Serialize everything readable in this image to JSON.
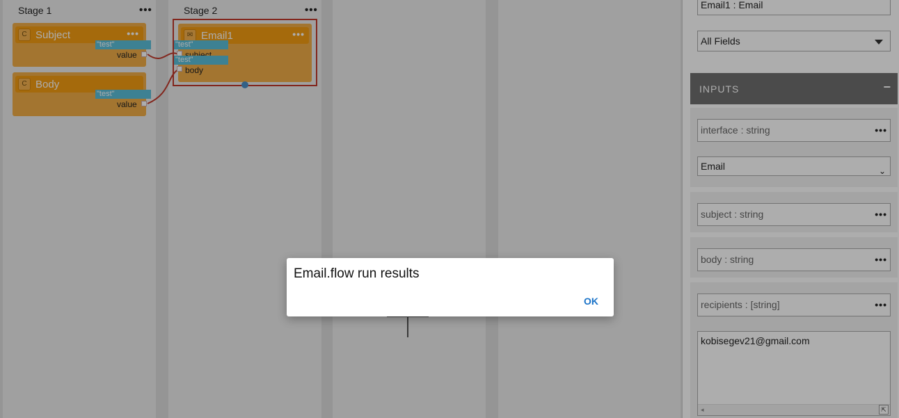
{
  "stages": [
    {
      "title": "Stage 1",
      "nodes": [
        {
          "icon": "C",
          "title": "Subject",
          "chip": "\"test\"",
          "port_label": "value"
        },
        {
          "icon": "C",
          "title": "Body",
          "chip": "\"test\"",
          "port_label": "value"
        }
      ]
    },
    {
      "title": "Stage 2",
      "nodes": [
        {
          "icon": "✉",
          "title": "Email1",
          "chips": [
            "\"test\"",
            "\"test\""
          ],
          "ports": [
            "subject",
            "body"
          ]
        }
      ]
    }
  ],
  "panel": {
    "node_name": "Email1 : Email",
    "filter_select": "All Fields",
    "inputs_title": "INPUTS",
    "inputs_toggle": "−",
    "fields": {
      "interface_label": "interface : string",
      "interface_value": "Email",
      "subject_label": "subject : string",
      "body_label": "body : string",
      "recipients_label": "recipients : [string]",
      "recipients_value": "kobisegev21@gmail.com"
    }
  },
  "dialog": {
    "title": "Email.flow run results",
    "ok_label": "OK"
  },
  "colors": {
    "node_fill": "#f0ad48",
    "node_header": "#f39c12",
    "chip": "#5bbfd9",
    "selection": "#c0392b",
    "accent_link": "#1a73c8"
  }
}
